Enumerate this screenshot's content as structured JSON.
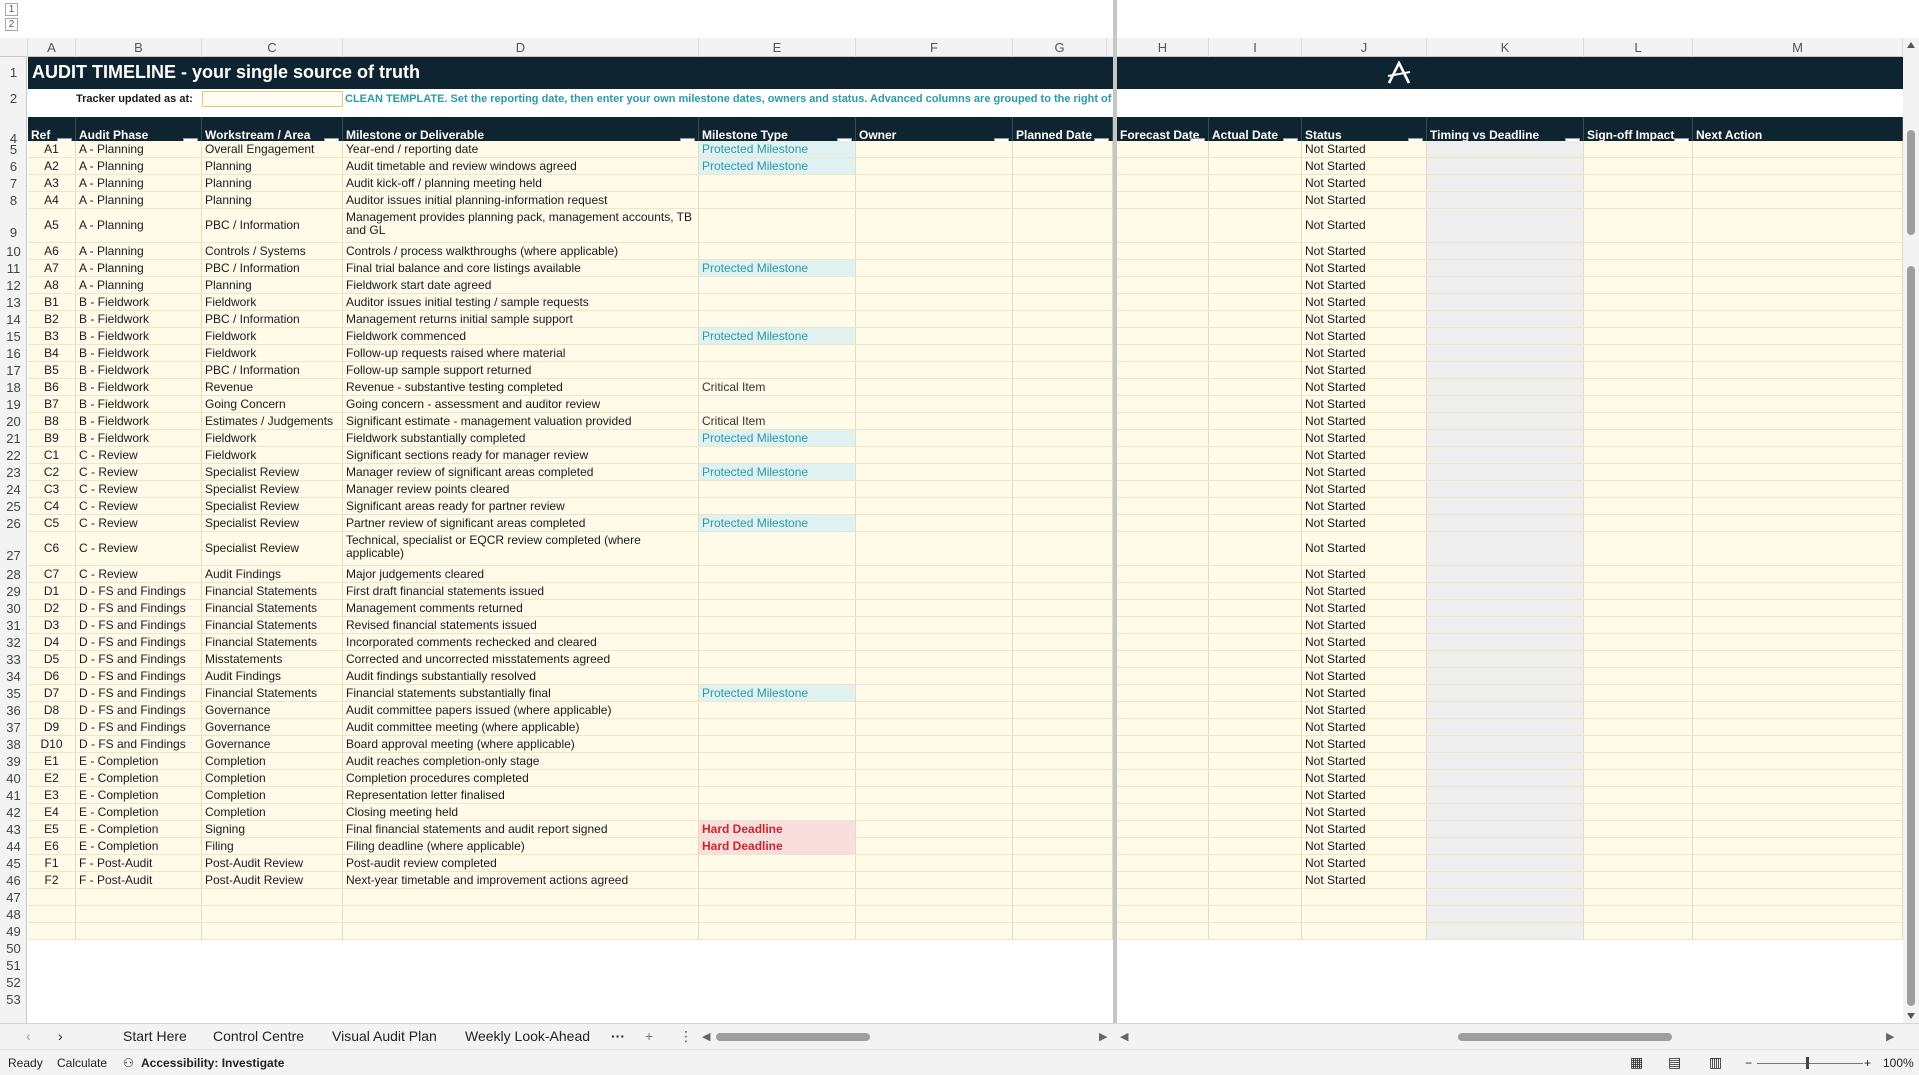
{
  "outline_levels": [
    "1",
    "2"
  ],
  "columns_left": [
    "A",
    "B",
    "C",
    "D",
    "E",
    "F",
    "G"
  ],
  "columns_right": [
    "H",
    "I",
    "J",
    "K",
    "L",
    "M"
  ],
  "row_numbers": [
    "1",
    "2",
    "4",
    "5",
    "6",
    "7",
    "8",
    "9",
    "10",
    "11",
    "12",
    "13",
    "14",
    "15",
    "16",
    "17",
    "18",
    "19",
    "20",
    "21",
    "22",
    "23",
    "24",
    "25",
    "26",
    "27",
    "28",
    "29",
    "30",
    "31",
    "32",
    "33",
    "34",
    "35",
    "36",
    "37",
    "38",
    "39",
    "40",
    "41",
    "42",
    "43",
    "44",
    "45",
    "46",
    "47",
    "48",
    "49",
    "50",
    "51",
    "52",
    "53"
  ],
  "title": "AUDIT TIMELINE  -  your single source of truth",
  "tracker_label": "Tracker updated as at:",
  "template_note": "CLEAN TEMPLATE.  Set the reporting date, then enter your own milestone dates, owners and status. Advanced columns are grouped to the right of Resolve By - use the [+] outline button to expand them. Confirm auditor-owned dates with your auditor.",
  "logo_letter": "A",
  "headers": {
    "ref": "Ref",
    "phase": "Audit Phase",
    "workstream": "Workstream / Area",
    "milestone": "Milestone or Deliverable",
    "type": "Milestone Type",
    "owner": "Owner",
    "planned": "Planned Date",
    "forecast": "Forecast Date",
    "actual": "Actual Date",
    "status": "Status",
    "timing": "Timing vs Deadline",
    "signoff": "Sign-off Impact",
    "next": "Next Action"
  },
  "rows": [
    {
      "ref": "A1",
      "phase": "A - Planning",
      "area": "Overall Engagement",
      "milestone": "Year-end / reporting date",
      "type": "Protected Milestone",
      "status": "Not Started"
    },
    {
      "ref": "A2",
      "phase": "A - Planning",
      "area": "Planning",
      "milestone": "Audit timetable and review windows agreed",
      "type": "Protected Milestone",
      "status": "Not Started"
    },
    {
      "ref": "A3",
      "phase": "A - Planning",
      "area": "Planning",
      "milestone": "Audit kick-off / planning meeting held",
      "type": "",
      "status": "Not Started"
    },
    {
      "ref": "A4",
      "phase": "A - Planning",
      "area": "Planning",
      "milestone": "Auditor issues initial planning-information request",
      "type": "",
      "status": "Not Started"
    },
    {
      "ref": "A5",
      "phase": "A - Planning",
      "area": "PBC / Information",
      "milestone": "Management provides planning pack, management accounts, TB and GL",
      "type": "",
      "status": "Not Started",
      "tall": true
    },
    {
      "ref": "A6",
      "phase": "A - Planning",
      "area": "Controls / Systems",
      "milestone": "Controls / process walkthroughs (where applicable)",
      "type": "",
      "status": "Not Started"
    },
    {
      "ref": "A7",
      "phase": "A - Planning",
      "area": "PBC / Information",
      "milestone": "Final trial balance and core listings available",
      "type": "Protected Milestone",
      "status": "Not Started"
    },
    {
      "ref": "A8",
      "phase": "A - Planning",
      "area": "Planning",
      "milestone": "Fieldwork start date agreed",
      "type": "",
      "status": "Not Started"
    },
    {
      "ref": "B1",
      "phase": "B - Fieldwork",
      "area": "Fieldwork",
      "milestone": "Auditor issues initial testing / sample requests",
      "type": "",
      "status": "Not Started"
    },
    {
      "ref": "B2",
      "phase": "B - Fieldwork",
      "area": "PBC / Information",
      "milestone": "Management returns initial sample support",
      "type": "",
      "status": "Not Started"
    },
    {
      "ref": "B3",
      "phase": "B - Fieldwork",
      "area": "Fieldwork",
      "milestone": "Fieldwork commenced",
      "type": "Protected Milestone",
      "status": "Not Started"
    },
    {
      "ref": "B4",
      "phase": "B - Fieldwork",
      "area": "Fieldwork",
      "milestone": "Follow-up requests raised where material",
      "type": "",
      "status": "Not Started"
    },
    {
      "ref": "B5",
      "phase": "B - Fieldwork",
      "area": "PBC / Information",
      "milestone": "Follow-up sample support returned",
      "type": "",
      "status": "Not Started"
    },
    {
      "ref": "B6",
      "phase": "B - Fieldwork",
      "area": "Revenue",
      "milestone": "Revenue - substantive testing completed",
      "type": "Critical Item",
      "status": "Not Started"
    },
    {
      "ref": "B7",
      "phase": "B - Fieldwork",
      "area": "Going Concern",
      "milestone": "Going concern - assessment and auditor review",
      "type": "",
      "status": "Not Started"
    },
    {
      "ref": "B8",
      "phase": "B - Fieldwork",
      "area": "Estimates / Judgements",
      "milestone": "Significant estimate - management valuation provided",
      "type": "Critical Item",
      "status": "Not Started"
    },
    {
      "ref": "B9",
      "phase": "B - Fieldwork",
      "area": "Fieldwork",
      "milestone": "Fieldwork substantially completed",
      "type": "Protected Milestone",
      "status": "Not Started"
    },
    {
      "ref": "C1",
      "phase": "C - Review",
      "area": "Fieldwork",
      "milestone": "Significant sections ready for manager review",
      "type": "",
      "status": "Not Started"
    },
    {
      "ref": "C2",
      "phase": "C - Review",
      "area": "Specialist Review",
      "milestone": "Manager review of significant areas completed",
      "type": "Protected Milestone",
      "status": "Not Started"
    },
    {
      "ref": "C3",
      "phase": "C - Review",
      "area": "Specialist Review",
      "milestone": "Manager review points cleared",
      "type": "",
      "status": "Not Started"
    },
    {
      "ref": "C4",
      "phase": "C - Review",
      "area": "Specialist Review",
      "milestone": "Significant areas ready for partner review",
      "type": "",
      "status": "Not Started"
    },
    {
      "ref": "C5",
      "phase": "C - Review",
      "area": "Specialist Review",
      "milestone": "Partner review of significant areas completed",
      "type": "Protected Milestone",
      "status": "Not Started"
    },
    {
      "ref": "C6",
      "phase": "C - Review",
      "area": "Specialist Review",
      "milestone": "Technical, specialist or EQCR review completed (where applicable)",
      "type": "",
      "status": "Not Started",
      "tall": true
    },
    {
      "ref": "C7",
      "phase": "C - Review",
      "area": "Audit Findings",
      "milestone": "Major judgements cleared",
      "type": "",
      "status": "Not Started"
    },
    {
      "ref": "D1",
      "phase": "D - FS and Findings",
      "area": "Financial Statements",
      "milestone": "First draft financial statements issued",
      "type": "",
      "status": "Not Started"
    },
    {
      "ref": "D2",
      "phase": "D - FS and Findings",
      "area": "Financial Statements",
      "milestone": "Management comments returned",
      "type": "",
      "status": "Not Started"
    },
    {
      "ref": "D3",
      "phase": "D - FS and Findings",
      "area": "Financial Statements",
      "milestone": "Revised financial statements issued",
      "type": "",
      "status": "Not Started"
    },
    {
      "ref": "D4",
      "phase": "D - FS and Findings",
      "area": "Financial Statements",
      "milestone": "Incorporated comments rechecked and cleared",
      "type": "",
      "status": "Not Started"
    },
    {
      "ref": "D5",
      "phase": "D - FS and Findings",
      "area": "Misstatements",
      "milestone": "Corrected and uncorrected misstatements agreed",
      "type": "",
      "status": "Not Started"
    },
    {
      "ref": "D6",
      "phase": "D - FS and Findings",
      "area": "Audit Findings",
      "milestone": "Audit findings substantially resolved",
      "type": "",
      "status": "Not Started"
    },
    {
      "ref": "D7",
      "phase": "D - FS and Findings",
      "area": "Financial Statements",
      "milestone": "Financial statements substantially final",
      "type": "Protected Milestone",
      "status": "Not Started"
    },
    {
      "ref": "D8",
      "phase": "D - FS and Findings",
      "area": "Governance",
      "milestone": "Audit committee papers issued (where applicable)",
      "type": "",
      "status": "Not Started"
    },
    {
      "ref": "D9",
      "phase": "D - FS and Findings",
      "area": "Governance",
      "milestone": "Audit committee meeting (where applicable)",
      "type": "",
      "status": "Not Started"
    },
    {
      "ref": "D10",
      "phase": "D - FS and Findings",
      "area": "Governance",
      "milestone": "Board approval meeting (where applicable)",
      "type": "",
      "status": "Not Started"
    },
    {
      "ref": "E1",
      "phase": "E - Completion",
      "area": "Completion",
      "milestone": "Audit reaches completion-only stage",
      "type": "",
      "status": "Not Started"
    },
    {
      "ref": "E2",
      "phase": "E - Completion",
      "area": "Completion",
      "milestone": "Completion procedures completed",
      "type": "",
      "status": "Not Started"
    },
    {
      "ref": "E3",
      "phase": "E - Completion",
      "area": "Completion",
      "milestone": "Representation letter finalised",
      "type": "",
      "status": "Not Started"
    },
    {
      "ref": "E4",
      "phase": "E - Completion",
      "area": "Completion",
      "milestone": "Closing meeting held",
      "type": "",
      "status": "Not Started"
    },
    {
      "ref": "E5",
      "phase": "E - Completion",
      "area": "Signing",
      "milestone": "Final financial statements and audit report signed",
      "type": "Hard Deadline",
      "status": "Not Started"
    },
    {
      "ref": "E6",
      "phase": "E - Completion",
      "area": "Filing",
      "milestone": "Filing deadline (where applicable)",
      "type": "Hard Deadline",
      "status": "Not Started"
    },
    {
      "ref": "F1",
      "phase": "F - Post-Audit",
      "area": "Post-Audit Review",
      "milestone": "Post-audit review completed",
      "type": "",
      "status": "Not Started"
    },
    {
      "ref": "F2",
      "phase": "F - Post-Audit",
      "area": "Post-Audit Review",
      "milestone": "Next-year timetable and improvement actions agreed",
      "type": "",
      "status": "Not Started"
    }
  ],
  "sheet_tabs": [
    "Start Here",
    "Control Centre",
    "Visual Audit Plan",
    "Weekly Look-Ahead"
  ],
  "tab_overflow": "···",
  "tab_add": "+",
  "status_bar": {
    "ready": "Ready",
    "calculate": "Calculate",
    "accessibility": "Accessibility: Investigate",
    "zoom": "100%"
  },
  "colors": {
    "header_navy": "#0f2431",
    "row_fill": "#fffbe8",
    "protected_text": "#2a9aa6",
    "hard_deadline_text": "#c8282d"
  }
}
